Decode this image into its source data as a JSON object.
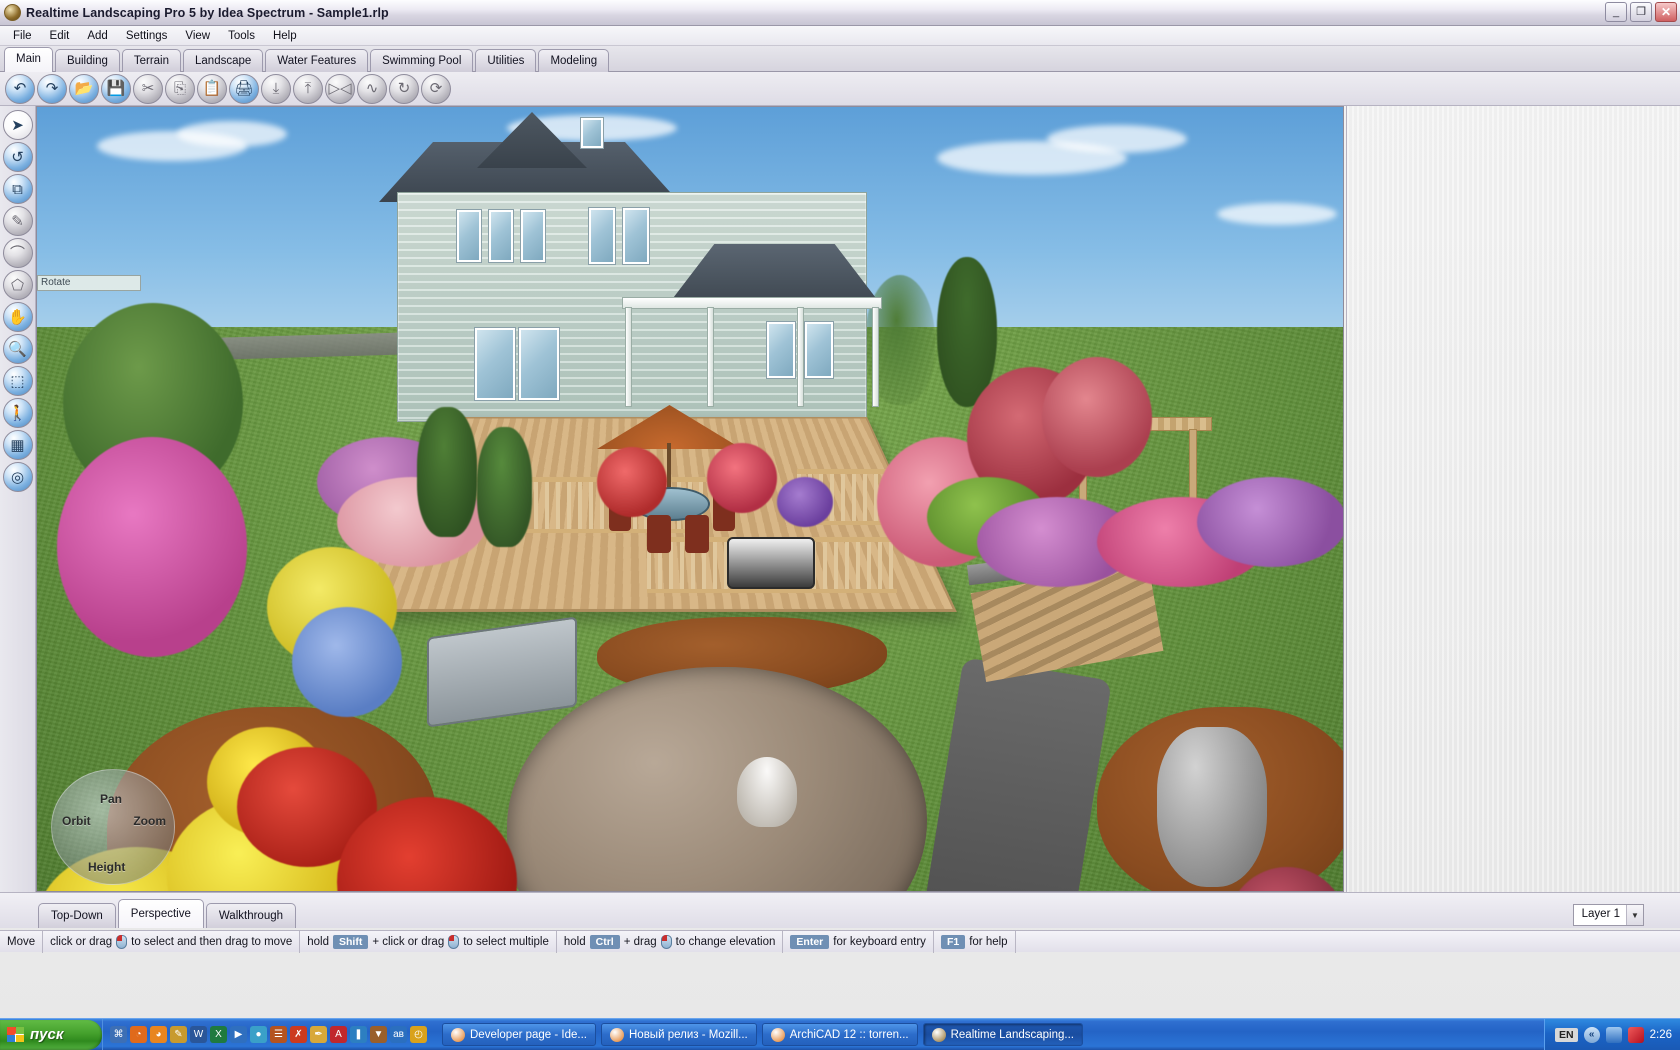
{
  "window": {
    "title": "Realtime Landscaping Pro 5 by Idea Spectrum - Sample1.rlp",
    "app_icon": "app-globe-icon",
    "minimize_glyph": "_",
    "maximize_glyph": "❐",
    "close_glyph": "✕"
  },
  "menu": {
    "items": [
      {
        "label": "File"
      },
      {
        "label": "Edit"
      },
      {
        "label": "Add"
      },
      {
        "label": "Settings"
      },
      {
        "label": "View"
      },
      {
        "label": "Tools"
      },
      {
        "label": "Help"
      }
    ]
  },
  "ribbon_tabs": [
    {
      "label": "Main",
      "active": true
    },
    {
      "label": "Building",
      "active": false
    },
    {
      "label": "Terrain",
      "active": false
    },
    {
      "label": "Landscape",
      "active": false
    },
    {
      "label": "Water Features",
      "active": false
    },
    {
      "label": "Swimming Pool",
      "active": false
    },
    {
      "label": "Utilities",
      "active": false
    },
    {
      "label": "Modeling",
      "active": false
    }
  ],
  "toolbar": {
    "buttons": [
      {
        "name": "undo-icon",
        "glyph": "↶",
        "style": "blue",
        "enabled": true
      },
      {
        "name": "redo-icon",
        "glyph": "↷",
        "style": "blue",
        "enabled": true
      },
      {
        "name": "open-folder-icon",
        "glyph": "📂",
        "style": "blue",
        "enabled": true
      },
      {
        "name": "save-icon",
        "glyph": "💾",
        "style": "blue",
        "enabled": true
      },
      {
        "name": "cut-icon",
        "glyph": "✂",
        "style": "gray",
        "enabled": false
      },
      {
        "name": "copy-icon",
        "glyph": "⎘",
        "style": "gray",
        "enabled": false
      },
      {
        "name": "paste-icon",
        "glyph": "📋",
        "style": "gray",
        "enabled": false
      },
      {
        "name": "print-icon",
        "glyph": "🖨",
        "style": "blue",
        "enabled": true
      },
      {
        "name": "align-bottom-icon",
        "glyph": "⤓",
        "style": "gray",
        "enabled": false
      },
      {
        "name": "align-top-icon",
        "glyph": "⤒",
        "style": "gray",
        "enabled": false
      },
      {
        "name": "mirror-icon",
        "glyph": "▷◁",
        "style": "gray",
        "enabled": false
      },
      {
        "name": "smooth-icon",
        "glyph": "∿",
        "style": "gray",
        "enabled": false
      },
      {
        "name": "rotate-icon",
        "glyph": "↻",
        "style": "gray",
        "enabled": false
      },
      {
        "name": "spin-icon",
        "glyph": "⟳",
        "style": "gray",
        "enabled": false
      }
    ]
  },
  "left_toolbar": {
    "buttons": [
      {
        "name": "select-arrow-tool",
        "glyph": "➤",
        "style": "white",
        "enabled": true
      },
      {
        "name": "rotate-object-tool",
        "glyph": "↺",
        "style": "blue",
        "enabled": true
      },
      {
        "name": "scale-object-tool",
        "glyph": "⧉",
        "style": "blue",
        "enabled": true
      },
      {
        "name": "paint-tool",
        "glyph": "✎",
        "style": "gray",
        "enabled": false
      },
      {
        "name": "curve-tool",
        "glyph": "⌒",
        "style": "gray",
        "enabled": false
      },
      {
        "name": "region-tool",
        "glyph": "⬠",
        "style": "gray",
        "enabled": false
      },
      {
        "name": "pan-hand-tool",
        "glyph": "✋",
        "style": "blue",
        "enabled": true
      },
      {
        "name": "zoom-tool",
        "glyph": "🔍",
        "style": "blue",
        "enabled": true
      },
      {
        "name": "zoom-window-tool",
        "glyph": "⬚",
        "style": "blue",
        "enabled": true
      },
      {
        "name": "walk-tool",
        "glyph": "🚶",
        "style": "blue",
        "enabled": true
      },
      {
        "name": "terrain-grid-tool",
        "glyph": "▦",
        "style": "blue",
        "enabled": true
      },
      {
        "name": "color-picker-tool",
        "glyph": "◎",
        "style": "blue",
        "enabled": true
      }
    ]
  },
  "viewport": {
    "tooltip_ghost": "Rotate",
    "compass": {
      "orbit_label": "Orbit",
      "zoom_label": "Zoom",
      "pan_label": "Pan",
      "height_label": "Height"
    }
  },
  "view_tabs": [
    {
      "label": "Top-Down",
      "active": false
    },
    {
      "label": "Perspective",
      "active": true
    },
    {
      "label": "Walkthrough",
      "active": false
    }
  ],
  "layer_selector": {
    "value": "Layer 1",
    "arrow_glyph": "▼"
  },
  "status_bar": {
    "mode": "Move",
    "hints": [
      {
        "pre": "click or drag",
        "mouse": true,
        "post": "to select and then drag to move",
        "key": null
      },
      {
        "pre": "hold",
        "mouse": false,
        "key": "Shift",
        "mid": "+ click or drag",
        "mouse2": true,
        "post": "to select multiple"
      },
      {
        "pre": "hold",
        "mouse": false,
        "key": "Ctrl",
        "mid": "+ drag",
        "mouse2": true,
        "post": "to change elevation"
      },
      {
        "pre": "",
        "key": "Enter",
        "post": "for keyboard entry"
      },
      {
        "pre": "",
        "key": "F1",
        "post": "for help"
      }
    ]
  },
  "taskbar": {
    "start_label": "пуск",
    "quick_launch": [
      {
        "name": "ql-icon-1",
        "glyph": "⌘",
        "color": "#3d6fb5"
      },
      {
        "name": "ql-firefox-icon",
        "glyph": "◔",
        "color": "#e06a1b"
      },
      {
        "name": "ql-firefox2-icon",
        "glyph": "◕",
        "color": "#e8851f"
      },
      {
        "name": "ql-paint-icon",
        "glyph": "✎",
        "color": "#c89a2f"
      },
      {
        "name": "ql-word-icon",
        "glyph": "W",
        "color": "#2a5699"
      },
      {
        "name": "ql-excel-icon",
        "glyph": "X",
        "color": "#1f7a3f"
      },
      {
        "name": "ql-media-icon",
        "glyph": "▶",
        "color": "#2f6fbf"
      },
      {
        "name": "ql-globe-icon",
        "glyph": "●",
        "color": "#3aa0c8"
      },
      {
        "name": "ql-archive-icon",
        "glyph": "☰",
        "color": "#b5531f"
      },
      {
        "name": "ql-runner-icon",
        "glyph": "✗",
        "color": "#cc3a1e"
      },
      {
        "name": "ql-pencil-icon",
        "glyph": "✒",
        "color": "#d8a83a"
      },
      {
        "name": "ql-acrobat-icon",
        "glyph": "A",
        "color": "#c1272d"
      },
      {
        "name": "ql-usb-icon",
        "glyph": "❚",
        "color": "#2d7fc1"
      },
      {
        "name": "ql-download-icon",
        "glyph": "▼",
        "color": "#9a5f2b"
      },
      {
        "name": "ql-abv-icon",
        "glyph": "ав",
        "color": "#2b6fbf"
      },
      {
        "name": "ql-clock-icon",
        "glyph": "◴",
        "color": "#d9a21c"
      }
    ],
    "tasks": [
      {
        "label": "Developer page - Ide...",
        "icon": "firefox-icon",
        "color": "#e0761b",
        "active": false
      },
      {
        "label": "Новый релиз - Mozill...",
        "icon": "firefox-icon",
        "color": "#e0761b",
        "active": false
      },
      {
        "label": "ArchiCAD 12 :: torren...",
        "icon": "firefox-icon",
        "color": "#e0761b",
        "active": false
      },
      {
        "label": "Realtime Landscaping...",
        "icon": "app-globe-icon",
        "color": "#8d6b2a",
        "active": true
      }
    ],
    "tray": {
      "language": "EN",
      "chevron_glyph": "«",
      "icons": [
        {
          "name": "network-icon",
          "color": "#2f6fbf"
        },
        {
          "name": "antivirus-icon",
          "color": "#cf1f2d"
        }
      ],
      "clock": "2:26"
    }
  }
}
